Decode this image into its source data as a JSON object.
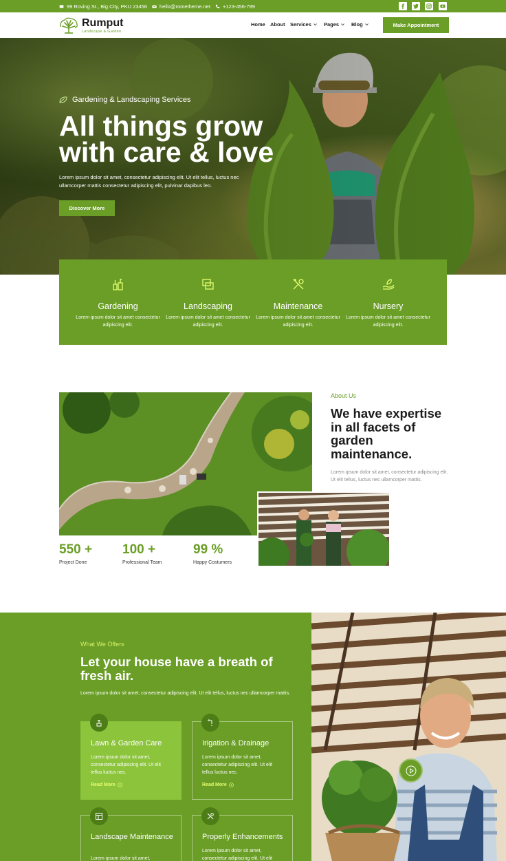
{
  "topbar": {
    "address": "99 Roving St., Big City, PKU 23456",
    "email": "hello@rometheme.net",
    "phone": "+123-456-789",
    "socials": [
      "facebook-icon",
      "twitter-icon",
      "instagram-icon",
      "youtube-icon"
    ]
  },
  "nav": {
    "logo_name": "Rumput",
    "logo_tagline": "Landscape & Garden",
    "items": [
      "Home",
      "About",
      "Services",
      "Pages",
      "Blog"
    ],
    "cta": "Make Appointment"
  },
  "hero": {
    "kicker": "Gardening & Landscaping Services",
    "title": "All things grow with care & love",
    "text": "Lorem ipsum dolor sit amet, consectetur adipiscing elit. Ut elit tellus, luctus nec ullamcorper mattis consectetur adipiscing elit, pulvinar dapibus leo.",
    "button": "Discover More"
  },
  "services": [
    {
      "icon": "plant-pots-icon",
      "title": "Gardening",
      "text": "Lorem ipsum dolor sit amet consectetur adipiscing elit."
    },
    {
      "icon": "layers-icon",
      "title": "Landscaping",
      "text": "Lorem ipsum dolor sit amet consectetur adipiscing elit."
    },
    {
      "icon": "tools-icon",
      "title": "Maintenance",
      "text": "Lorem ipsum dolor sit amet consectetur adipiscing elit."
    },
    {
      "icon": "hand-leaf-icon",
      "title": "Nursery",
      "text": "Lorem ipsum dolor sit amet consectetur adipiscing elit."
    }
  ],
  "about": {
    "kicker": "About Us",
    "title": "We have expertise in all facets of garden maintenance.",
    "text": "Lorem ipsum dolor sit amet, consectetur adipiscing elit. Ut elit tellus, luctus nec ullamcorper mattis.",
    "stats": [
      {
        "value": "550 +",
        "label": "Project Done"
      },
      {
        "value": "100 +",
        "label": "Professional Team"
      },
      {
        "value": "99 %",
        "label": "Happy Costumers"
      }
    ]
  },
  "offers": {
    "kicker": "What We Offers",
    "title": "Let your house have a breath of fresh air.",
    "text": "Lorem ipsum dolor sit amet, consectetur adipiscing elit. Ut elit tellus, luctus nec ullamcorper mattis.",
    "cards": [
      {
        "icon": "plant-icon",
        "title": "Lawn & Garden Care",
        "text": "Lorem ipsum dolor sit amet, consectetur adipiscing elit. Ut elit tellus luctus nec.",
        "link": "Read More"
      },
      {
        "icon": "faucet-icon",
        "title": "Irigation & Drainage",
        "text": "Lorem ipsum dolor sit amet, consectetur adipiscing elit. Ut elit tellus luctus nec.",
        "link": "Read More"
      },
      {
        "icon": "layout-icon",
        "title": "Landscape Maintenance",
        "text": "Lorem ipsum dolor sit amet,"
      },
      {
        "icon": "tools-icon",
        "title": "Properly Enhancements",
        "text": "Lorem ipsum dolor sit amet, consectetur adipiscing elit. Ut elit"
      }
    ]
  },
  "colors": {
    "brand_green": "#6a9e26",
    "light_green": "#8cc43c",
    "accent_yellow": "#e5ff70"
  }
}
